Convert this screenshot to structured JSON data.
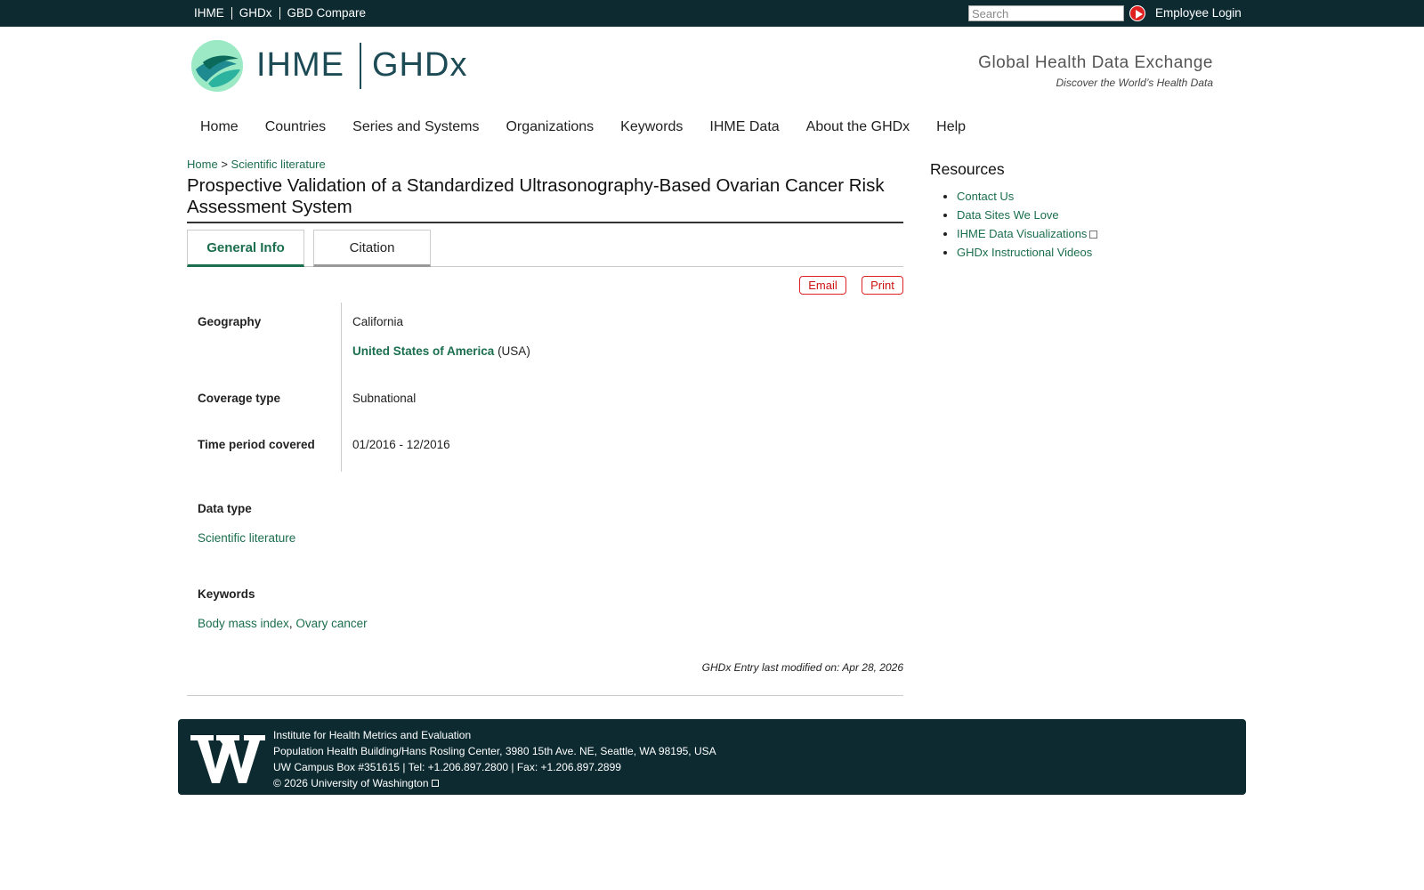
{
  "topbar": {
    "links": [
      "IHME",
      "GHDx",
      "GBD Compare"
    ],
    "search_placeholder": "Search",
    "employee_login": "Employee Login"
  },
  "header": {
    "logo_left": "IHME",
    "logo_right": "GHDx",
    "tagline_title": "Global Health Data Exchange",
    "tagline_sub": "Discover the World’s Health Data"
  },
  "nav": [
    "Home",
    "Countries",
    "Series and Systems",
    "Organizations",
    "Keywords",
    "IHME Data",
    "About the GHDx",
    "Help"
  ],
  "breadcrumb": {
    "home": "Home",
    "separator": ">",
    "current": "Scientific literature"
  },
  "page_title": "Prospective Validation of a Standardized Ultrasonography-Based Ovarian Cancer Risk Assessment System",
  "tabs": {
    "general": "General Info",
    "citation": "Citation"
  },
  "actions": {
    "email": "Email",
    "print": "Print"
  },
  "fields": {
    "geography_label": "Geography",
    "geography_value1": "California",
    "geography_link": "United States of America",
    "geography_suffix": "(USA)",
    "coverage_label": "Coverage type",
    "coverage_value": "Subnational",
    "time_label": "Time period covered",
    "time_value": "01/2016 - 12/2016"
  },
  "data_type": {
    "label": "Data type",
    "value": "Scientific literature"
  },
  "keywords": {
    "label": "Keywords",
    "k1": "Body mass index",
    "sep": ",",
    "k2": "Ovary cancer"
  },
  "modified": "GHDx Entry last modified on: Apr 28, 2026",
  "sidebar": {
    "title": "Resources",
    "items": [
      "Contact Us",
      "Data Sites We Love",
      "IHME Data Visualizations",
      "GHDx Instructional Videos"
    ]
  },
  "footer": {
    "line1": "Institute for Health Metrics and Evaluation",
    "line2": "Population Health Building/Hans Rosling Center, 3980 15th Ave. NE, Seattle, WA 98195, USA",
    "line3": "UW Campus Box #351615 | Tel: +1.206.897.2800 | Fax: +1.206.897.2899",
    "copyright": "© 2026",
    "uw_link": "University of Washington"
  },
  "colors": {
    "topbar": "#0c2a30",
    "link": "#1b6e4e",
    "accent_red": "#e02020"
  }
}
